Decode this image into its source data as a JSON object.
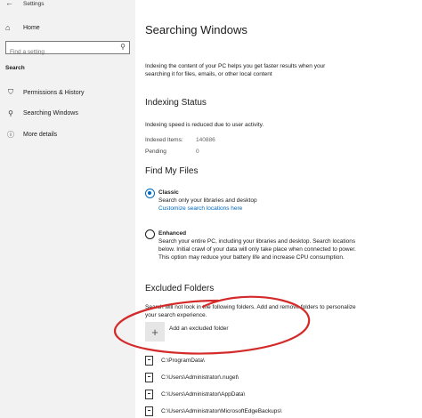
{
  "window": {
    "title": "Settings"
  },
  "sidebar": {
    "home_label": "Home",
    "search_placeholder": "Find a setting",
    "section_label": "Search",
    "items": [
      {
        "label": "Permissions & History",
        "icon": "shield-lock-icon"
      },
      {
        "label": "Searching Windows",
        "icon": "search-icon"
      },
      {
        "label": "More details",
        "icon": "info-icon"
      }
    ]
  },
  "main": {
    "title": "Searching Windows",
    "intro": "Indexing the content of your PC helps you get faster results when your searching it for files, emails, or other local content",
    "indexing_status": {
      "heading": "Indexing Status",
      "note": "Indexing speed is reduced due to user activity.",
      "indexed_label": "Indexed Items:",
      "indexed_value": "140886",
      "pending_label": "Pending",
      "pending_value": "0"
    },
    "find_my_files": {
      "heading": "Find My Files",
      "classic_title": "Classic",
      "classic_desc": "Search only your libraries and desktop",
      "classic_link": "Customize search locations here",
      "enhanced_title": "Enhanced",
      "enhanced_desc": "Search your entire PC, including your libraries and desktop. Search locations below. Initial crawl of your data will only take place when connected to power. This option may reduce your battery life and increase CPU consumption.",
      "selected": "Classic"
    },
    "excluded_folders": {
      "heading": "Excluded Folders",
      "desc": "Search will not look in the following folders. Add and remove folders to personalize your search experience.",
      "add_label": "Add an excluded folder",
      "folders": [
        "C:\\ProgramData\\",
        "C:\\Users\\Administrator\\.nuget\\",
        "C:\\Users\\Administrator\\AppData\\",
        "C:\\Users\\Administrator\\MicrosoftEdgeBackups\\"
      ]
    }
  },
  "colors": {
    "accent": "#0067c0",
    "annotation": "#d42a2a",
    "sidebar_bg": "#f2f2f2"
  }
}
